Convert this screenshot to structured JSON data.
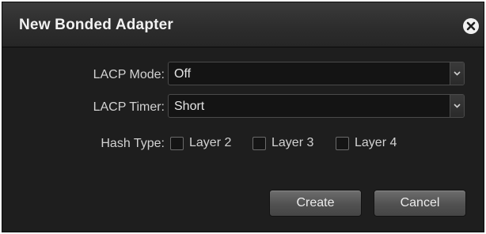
{
  "dialog": {
    "title": "New Bonded Adapter",
    "close_icon": "close-circle-icon"
  },
  "form": {
    "lacp_mode": {
      "label": "LACP Mode:",
      "value": "Off"
    },
    "lacp_timer": {
      "label": "LACP Timer:",
      "value": "Short"
    },
    "hash_type": {
      "label": "Hash Type:",
      "options": [
        {
          "label": "Layer 2",
          "checked": false
        },
        {
          "label": "Layer 3",
          "checked": false
        },
        {
          "label": "Layer 4",
          "checked": false
        }
      ]
    }
  },
  "buttons": {
    "create": "Create",
    "cancel": "Cancel"
  }
}
